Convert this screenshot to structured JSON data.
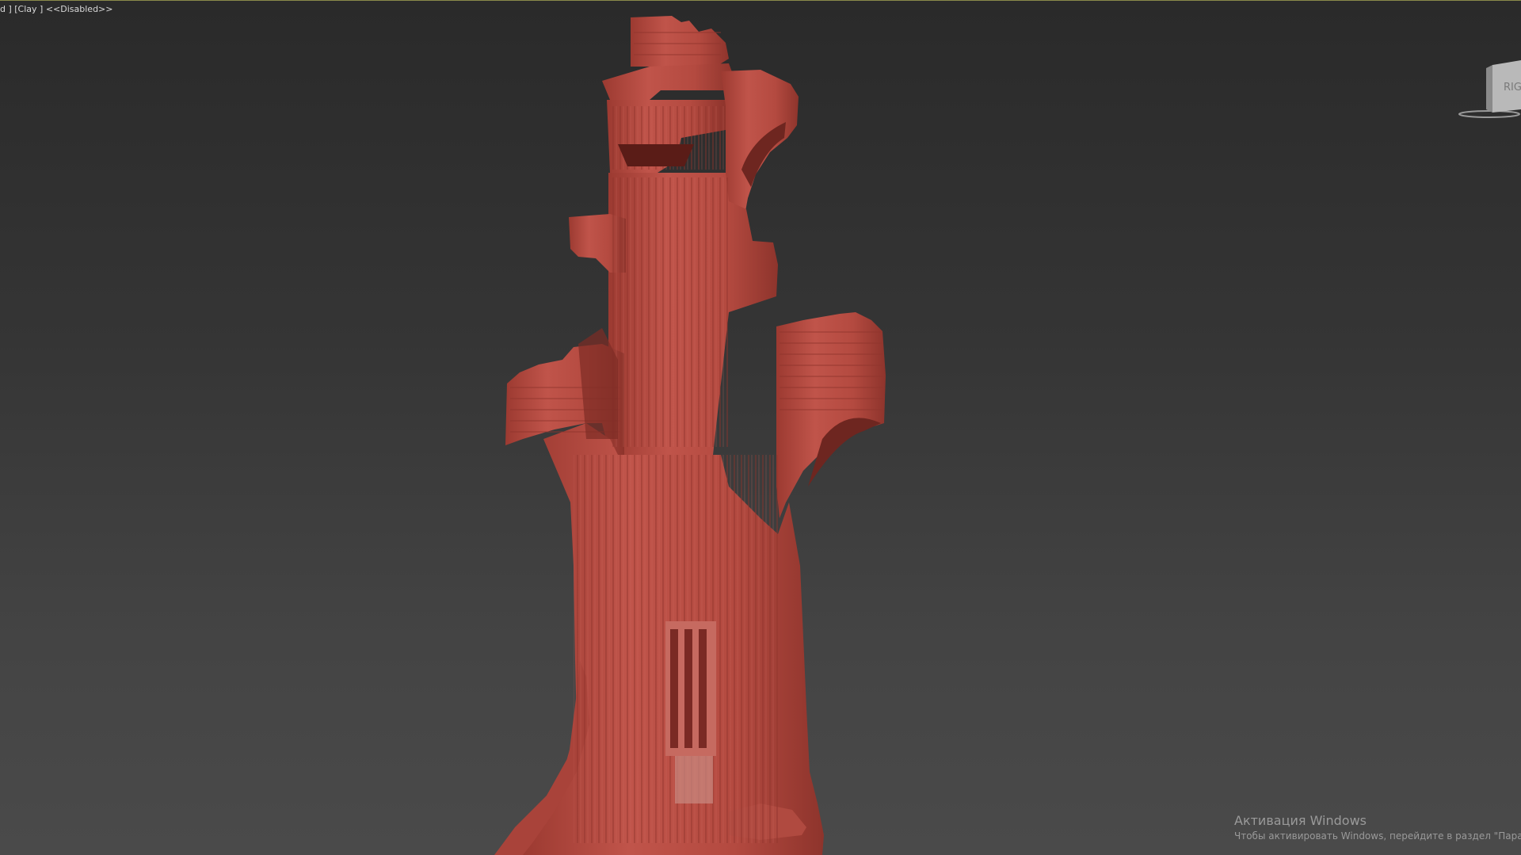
{
  "viewport": {
    "label": "d ] [Clay ] <<Disabled>>",
    "viewcube_face": "RIGHT",
    "model_color": "#b84b40",
    "background_top": "#2a2a2a",
    "background_bottom": "#4a4a4a"
  },
  "watermark": {
    "title": "Активация Windows",
    "subtitle": "Чтобы активировать Windows, перейдите в раздел \"Парамет"
  },
  "icons": {
    "viewcube": "viewcube-icon",
    "viewcube_compass": "compass-ring-icon"
  }
}
